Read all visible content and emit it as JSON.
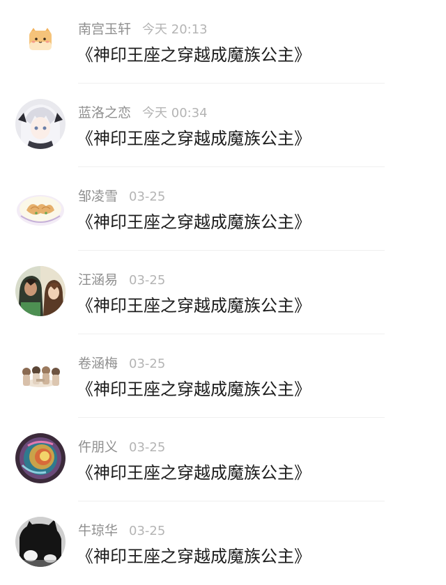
{
  "messages": [
    {
      "name": "南宫玉轩",
      "time": "今天 20:13",
      "text": "《神印王座之穿越成魔族公主》",
      "avatar": "cat-cartoon-avatar"
    },
    {
      "name": "蓝洛之恋",
      "time": "今天 00:34",
      "text": "《神印王座之穿越成魔族公主》",
      "avatar": "anime-girl-avatar"
    },
    {
      "name": "邹凌雪",
      "time": "03-25",
      "text": "《神印王座之穿越成魔族公主》",
      "avatar": "dumpling-plate-avatar"
    },
    {
      "name": "汪涵易",
      "time": "03-25",
      "text": "《神印王座之穿越成魔族公主》",
      "avatar": "anime-duo-avatar"
    },
    {
      "name": "卷涵梅",
      "time": "03-25",
      "text": "《神印王座之穿越成魔族公主》",
      "avatar": "tea-party-sketch-avatar"
    },
    {
      "name": "仵朋义",
      "time": "03-25",
      "text": "《神印王座之穿越成魔族公主》",
      "avatar": "colorful-swirl-avatar"
    },
    {
      "name": "牛琼华",
      "time": "03-25",
      "text": "《神印王座之穿越成魔族公主》",
      "avatar": "black-cat-avatar"
    }
  ]
}
